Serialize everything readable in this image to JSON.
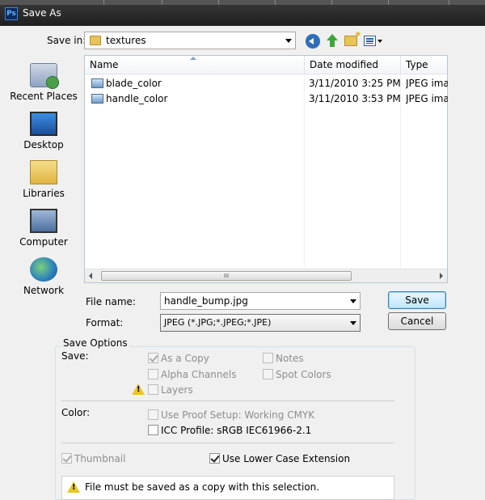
{
  "window": {
    "title": "Save As",
    "app_icon": "Ps"
  },
  "save_in": {
    "label": "Save in:",
    "value": "textures"
  },
  "places": [
    {
      "label": "Recent Places",
      "icon": "recent-places-icon"
    },
    {
      "label": "Desktop",
      "icon": "desktop-icon"
    },
    {
      "label": "Libraries",
      "icon": "libraries-icon"
    },
    {
      "label": "Computer",
      "icon": "computer-icon"
    },
    {
      "label": "Network",
      "icon": "network-icon"
    }
  ],
  "file_list": {
    "columns": [
      "Name",
      "Date modified",
      "Type"
    ],
    "rows": [
      {
        "name": "blade_color",
        "date": "3/11/2010 3:25 PM",
        "type": "JPEG image"
      },
      {
        "name": "handle_color",
        "date": "3/11/2010 3:53 PM",
        "type": "JPEG image"
      }
    ],
    "scroll_grip": "III"
  },
  "file_name": {
    "label": "File name:",
    "value": "handle_bump.jpg"
  },
  "format": {
    "label": "Format:",
    "value": "JPEG (*.JPG;*.JPEG;*.JPE)"
  },
  "buttons": {
    "save": "Save",
    "cancel": "Cancel"
  },
  "save_options": {
    "title": "Save Options",
    "save_label": "Save:",
    "as_a_copy": {
      "label": "As a Copy",
      "checked": true,
      "enabled": false
    },
    "notes": {
      "label": "Notes",
      "checked": false,
      "enabled": false
    },
    "alpha_channels": {
      "label": "Alpha Channels",
      "checked": false,
      "enabled": false
    },
    "spot_colors": {
      "label": "Spot Colors",
      "checked": false,
      "enabled": false
    },
    "layers": {
      "label": "Layers",
      "checked": false,
      "enabled": false
    },
    "color_label": "Color:",
    "use_proof_setup": {
      "label": "Use Proof Setup:  Working CMYK",
      "checked": false,
      "enabled": false
    },
    "icc_profile": {
      "label": "ICC Profile:  sRGB IEC61966-2.1",
      "checked": false,
      "enabled": true
    },
    "thumbnail": {
      "label": "Thumbnail",
      "checked": true,
      "enabled": false
    },
    "lower_case_ext": {
      "label": "Use Lower Case Extension",
      "checked": true,
      "enabled": true
    },
    "warning": "File must be saved as a copy with this selection."
  }
}
